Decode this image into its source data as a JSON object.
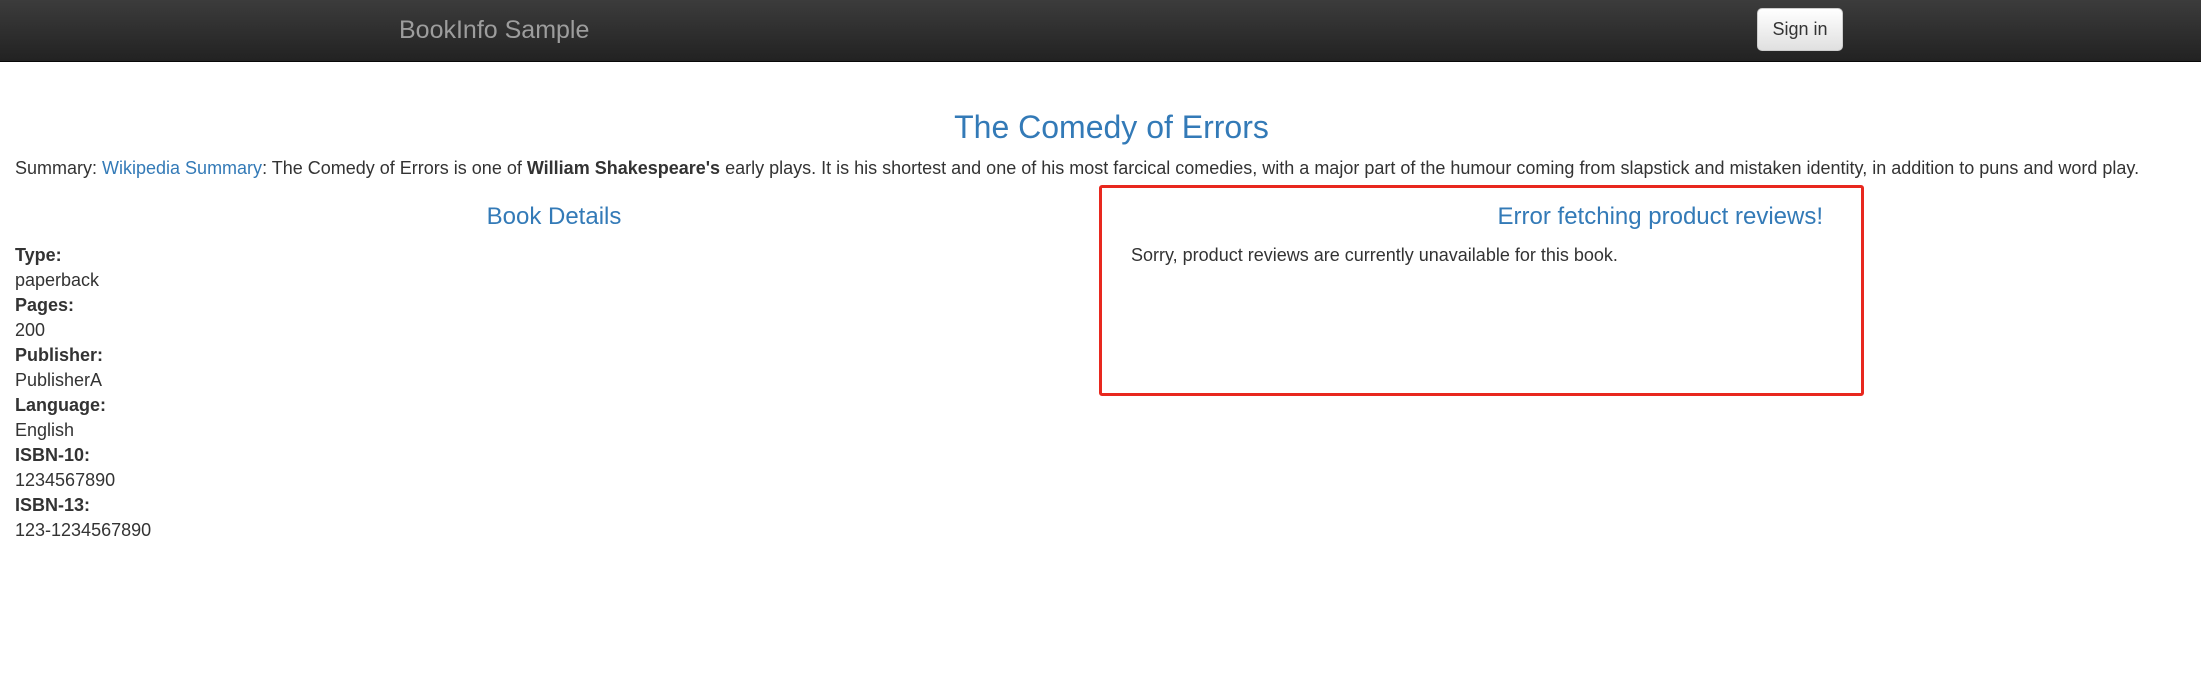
{
  "navbar": {
    "brand": "BookInfo Sample",
    "sign_in_label": "Sign in"
  },
  "book": {
    "title": "The Comedy of Errors",
    "summary": {
      "prefix": "Summary: ",
      "link_text": "Wikipedia Summary",
      "text_before_bold": ": The Comedy of Errors is one of ",
      "bold_text": "William Shakespeare's",
      "text_after_bold": " early plays. It is his shortest and one of his most farcical comedies, with a major part of the humour coming from slapstick and mistaken identity, in addition to puns and word play."
    }
  },
  "details": {
    "heading": "Book Details",
    "fields": [
      {
        "label": "Type:",
        "value": "paperback"
      },
      {
        "label": "Pages:",
        "value": "200"
      },
      {
        "label": "Publisher:",
        "value": "PublisherA"
      },
      {
        "label": "Language:",
        "value": "English"
      },
      {
        "label": "ISBN-10:",
        "value": "1234567890"
      },
      {
        "label": "ISBN-13:",
        "value": "123-1234567890"
      }
    ]
  },
  "reviews": {
    "heading": "Error fetching product reviews!",
    "message": "Sorry, product reviews are currently unavailable for this book.",
    "highlight_color": "#e8281e"
  },
  "colors": {
    "link": "#337ab7",
    "navbar": "#222222",
    "brand": "#9d9d9d"
  }
}
